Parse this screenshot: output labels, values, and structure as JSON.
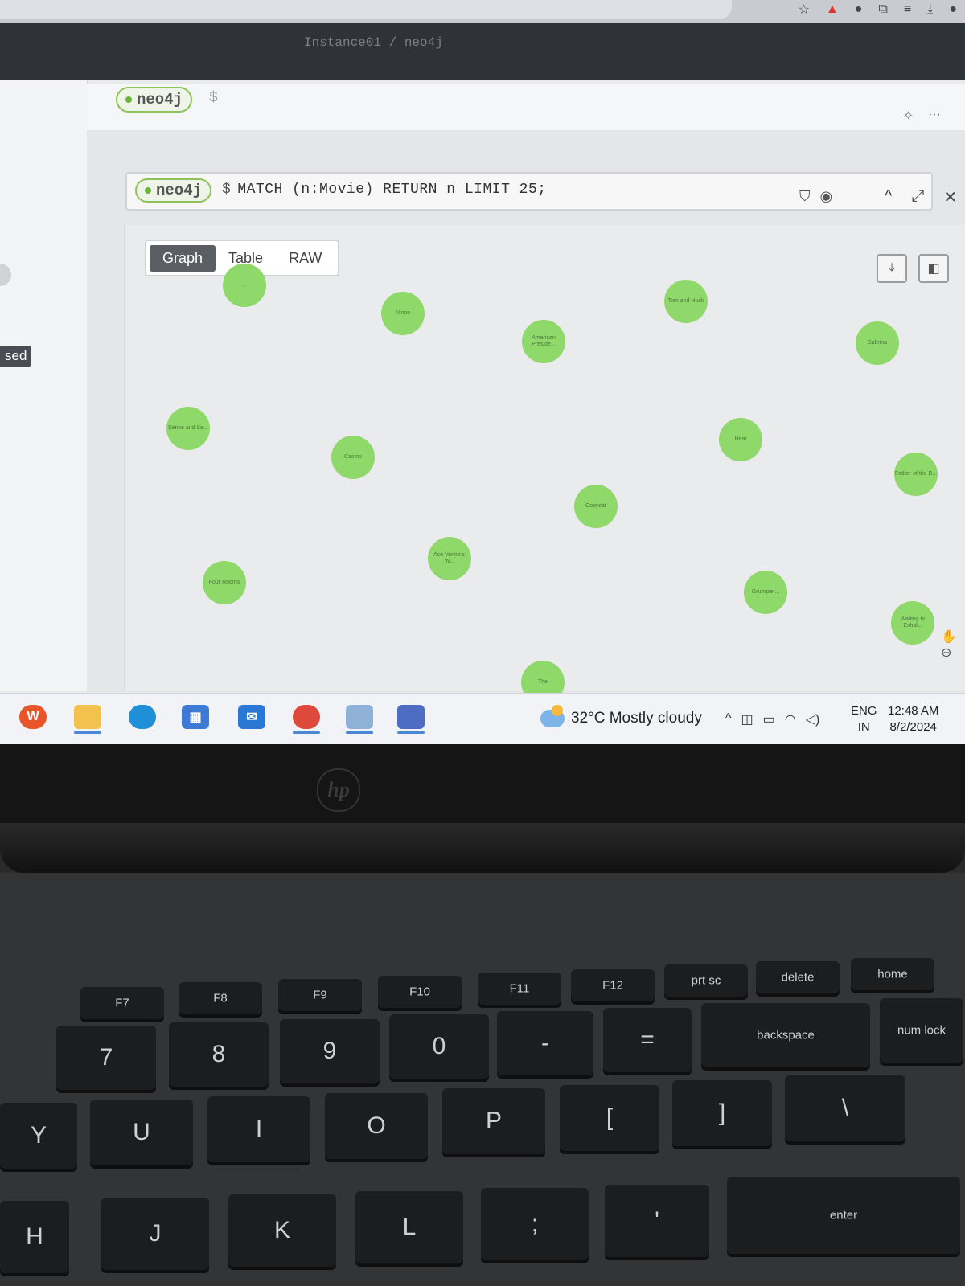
{
  "browser": {
    "title": "Instance01 / neo4j"
  },
  "side_tag": "sed",
  "editor": {
    "db_label": "neo4j",
    "prompt": "$"
  },
  "frame": {
    "db_label": "neo4j",
    "prompt": "$",
    "query": "MATCH (n:Movie) RETURN n LIMIT 25;"
  },
  "view_tabs": [
    "Graph",
    "Table",
    "RAW"
  ],
  "nodes": [
    "...",
    "Ninon",
    "America­n Preside...",
    "Tom and Huck",
    "Sabrina",
    "Sense and Se...",
    "Casino",
    "Heat",
    "Father of the B...",
    "Copycat",
    "Four Rooms",
    "Ace Ventura: W...",
    "Grumpi­er...",
    "Waiting to Exhal...",
    "The"
  ],
  "taskbar": {
    "weather": "32°C  Mostly cloudy",
    "lang_top": "ENG",
    "lang_bottom": "IN",
    "time": "12:48 AM",
    "date": "8/2/2024"
  },
  "laptop": {
    "brand": "hp"
  },
  "keyboard": {
    "fn_row": [
      "F7",
      "F8",
      "F9",
      "F10",
      "F11",
      "F12",
      "prt sc",
      "delete",
      "home"
    ],
    "num_row": [
      "7",
      "8",
      "9",
      "0",
      "-",
      "=",
      "backspace",
      "num lock"
    ],
    "top_row": [
      "Y",
      "U",
      "I",
      "O",
      "P",
      "[",
      "]",
      "\\"
    ],
    "home_row": [
      "H",
      "J",
      "K",
      "L",
      ";",
      "'",
      "enter"
    ]
  }
}
